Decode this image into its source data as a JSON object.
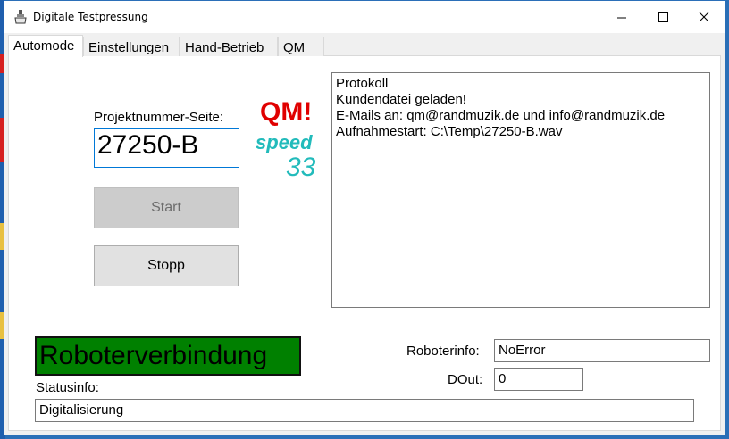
{
  "window": {
    "title": "Digitale Testpressung"
  },
  "tabs": [
    {
      "label": "Automode"
    },
    {
      "label": "Einstellungen"
    },
    {
      "label": "Hand-Betrieb"
    },
    {
      "label": "QM"
    }
  ],
  "main": {
    "project_label": "Projektnummer-Seite:",
    "project_value": "27250-B",
    "start_label": "Start",
    "stop_label": "Stopp",
    "qm_logo": {
      "qm": "QM!",
      "speed": "speed",
      "number": "33"
    },
    "protocol": [
      "Protokoll",
      "Kundendatei geladen!",
      "E-Mails an: qm@randmuzik.de und info@randmuzik.de",
      "Aufnahmestart: C:\\Temp\\27250-B.wav"
    ],
    "robot_connection_label": "Roboterverbindung",
    "robot_info_label": "Roboterinfo:",
    "robot_info_value": "NoError",
    "dout_label": "DOut:",
    "dout_value": "0",
    "status_label": "Statusinfo:",
    "status_value": "Digitalisierung"
  },
  "colors": {
    "robot_connection_bg": "#008000",
    "qm_red": "#e00000",
    "speed_teal": "#22bbbb"
  }
}
